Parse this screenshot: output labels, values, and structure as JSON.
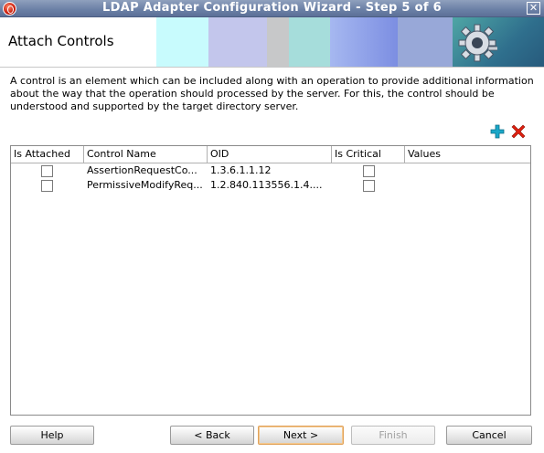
{
  "window": {
    "title": "LDAP Adapter Configuration Wizard - Step 5 of 6",
    "close_glyph": "✕"
  },
  "header": {
    "title": "Attach Controls"
  },
  "description": "A control is an element which can be included along with an operation to provide additional information about the way that the operation should processed by the server. For this, the control should be understood and supported by the target directory server.",
  "toolbar": {
    "add_icon": "add-icon",
    "remove_icon": "remove-icon",
    "colors": {
      "add": "#1aa7c8",
      "remove": "#e02010"
    }
  },
  "table": {
    "columns": [
      "Is Attached",
      "Control Name",
      "OID",
      "Is Critical",
      "Values"
    ],
    "rows": [
      {
        "is_attached": false,
        "control_name": "AssertionRequestCo...",
        "oid": "1.3.6.1.1.12",
        "is_critical": false,
        "values": ""
      },
      {
        "is_attached": false,
        "control_name": "PermissiveModifyReq...",
        "oid": "1.2.840.113556.1.4....",
        "is_critical": false,
        "values": ""
      }
    ]
  },
  "buttons": {
    "help": "Help",
    "back": "< Back",
    "next": "Next >",
    "finish": "Finish",
    "cancel": "Cancel"
  }
}
